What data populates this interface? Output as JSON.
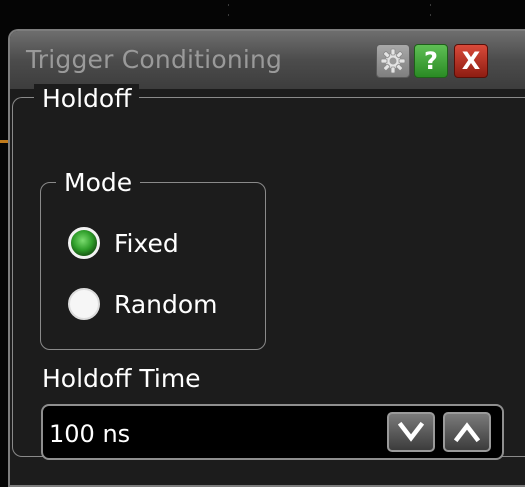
{
  "dialog": {
    "title": "Trigger Conditioning",
    "buttons": {
      "settings_icon": "gear-icon",
      "help_glyph": "?",
      "close_glyph": "X"
    }
  },
  "holdoff": {
    "group_label": "Holdoff",
    "mode": {
      "group_label": "Mode",
      "options": [
        {
          "label": "Fixed",
          "selected": true
        },
        {
          "label": "Random",
          "selected": false
        }
      ]
    },
    "time": {
      "label": "Holdoff Time",
      "value": "100 ns",
      "decrement_icon": "chevron-down-icon",
      "increment_icon": "chevron-up-icon"
    }
  },
  "colors": {
    "background": "#050505",
    "panel": "#1c1c1c",
    "selected_radio": "#2f9e2a",
    "help_button": "#2a8b24",
    "close_button": "#b52c1f"
  }
}
